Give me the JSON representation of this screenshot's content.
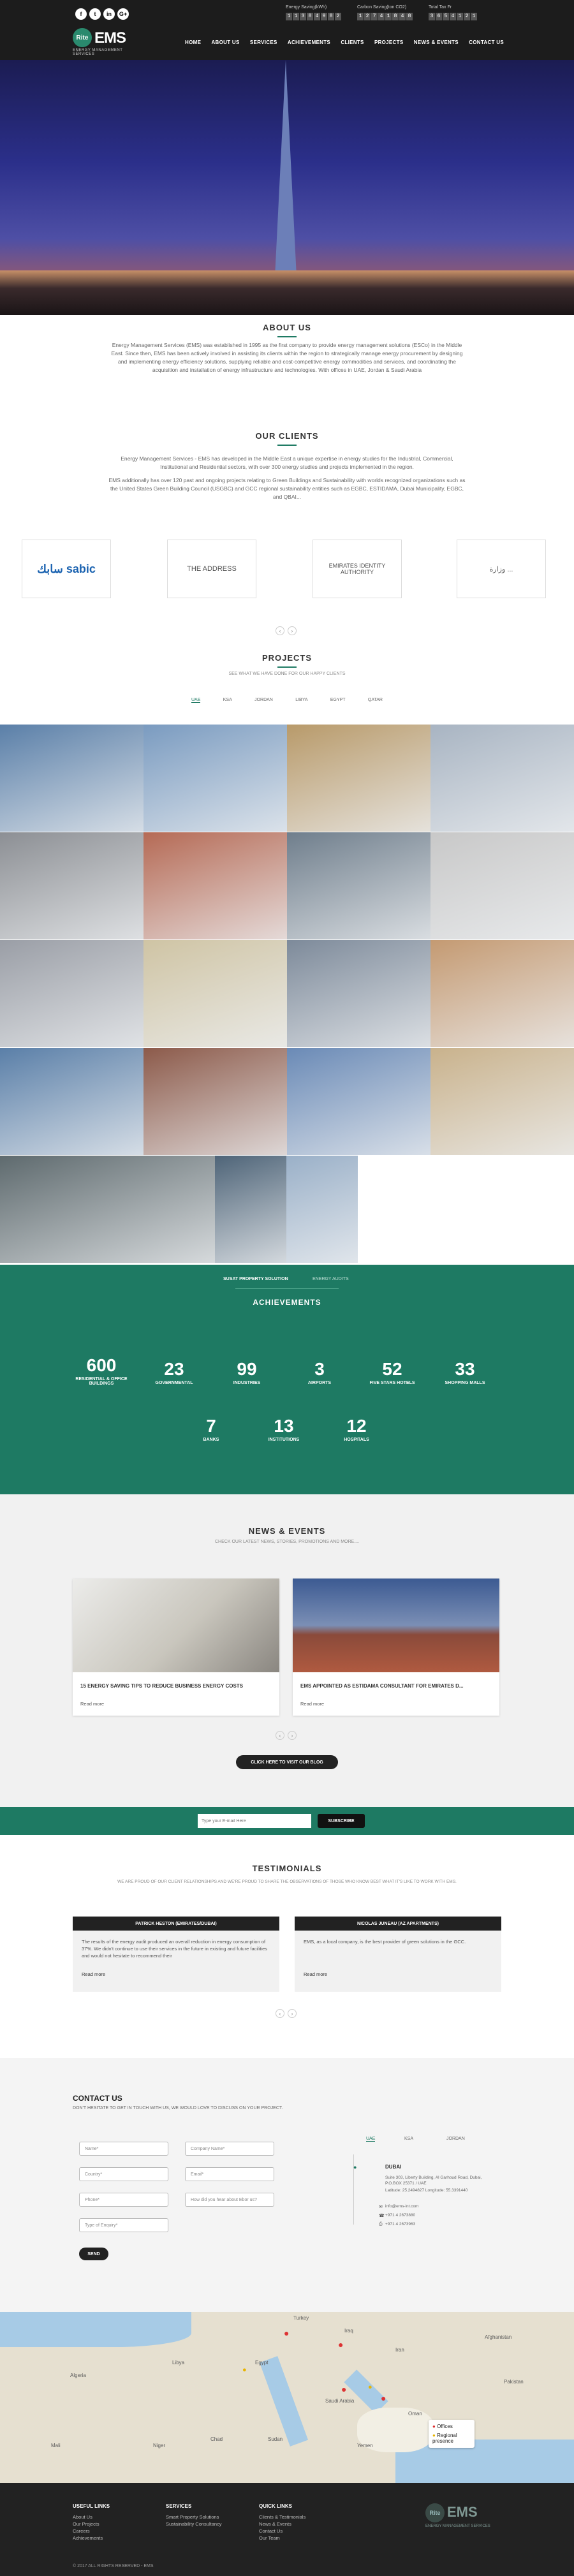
{
  "header": {
    "social": [
      "f",
      "t",
      "in",
      "G+"
    ],
    "logo": {
      "mark": "Rite",
      "name": "EMS",
      "tagline": "ENERGY MANAGEMENT SERVICES"
    },
    "stats": [
      {
        "label": "Energy Saving(kWh)",
        "digits": "11384982"
      },
      {
        "label": "Carbon Saving(ton CO2)",
        "digits": "12741848"
      },
      {
        "label": "Total Tax Fr",
        "digits": "3654121"
      }
    ],
    "nav": [
      "HOME",
      "ABOUT US",
      "SERVICES",
      "ACHIEVEMENTS",
      "CLIENTS",
      "PROJECTS",
      "NEWS & EVENTS",
      "CONTACT US"
    ]
  },
  "about": {
    "title": "ABOUT US",
    "text": "Energy Management Services (EMS) was established in 1995 as the first company to provide energy management solutions (ESCo) in the Middle East. Since then, EMS has been actively involved in assisting its clients within the region to strategically manage energy procurement by designing and implementing energy efficiency solutions, supplying reliable and cost-competitive energy commodities and services, and coordinating the acquisition and installation of energy infrastructure and technologies. With offices in UAE, Jordan & Saudi Arabia"
  },
  "clients": {
    "title": "OUR CLIENTS",
    "text1": "Energy Management Services - EMS has developed in the Middle East a unique expertise in energy studies for the Industrial, Commercial, Institutional and Residential sectors, with over 300 energy studies and projects implemented in the region.",
    "text2": "EMS additionally has over 120 past and ongoing projects relating to Green Buildings and Sustainability with worlds recognized organizations such as the United States Green Building Council (USGBC) and GCC regional sustainability entities such as EGBC, ESTIDAMA, Dubai Municipality, EGBC, and QBAI...",
    "logos": [
      "سابك sabic",
      "THE ADDRESS",
      "EMIRATES IDENTITY AUTHORITY",
      "وزارة ..."
    ]
  },
  "projects": {
    "title": "PROJECTS",
    "subtitle": "SEE WHAT WE HAVE DONE FOR OUR HAPPY CLIENTS",
    "tabs": [
      "UAE",
      "KSA",
      "JORDAN",
      "LIBYA",
      "EGYPT",
      "QATAR"
    ]
  },
  "achievements": {
    "title": "ACHIEVEMENTS",
    "tabs": [
      "SUSAT PROPERTY SOLUTION",
      "ENERGY AUDITS"
    ],
    "items": [
      {
        "n": "600",
        "l": "RESIDENTIAL & OFFICE BUILDINGS"
      },
      {
        "n": "23",
        "l": "GOVERNMENTAL"
      },
      {
        "n": "99",
        "l": "INDUSTRIES"
      },
      {
        "n": "3",
        "l": "AIRPORTS"
      },
      {
        "n": "52",
        "l": "FIVE STARS HOTELS"
      },
      {
        "n": "33",
        "l": "SHOPPING MALLS"
      },
      {
        "n": "7",
        "l": "BANKS"
      },
      {
        "n": "13",
        "l": "INSTITUTIONS"
      },
      {
        "n": "12",
        "l": "HOSPITALS"
      }
    ]
  },
  "news": {
    "title": "NEWS & EVENTS",
    "subtitle": "CHECK OUR LATEST NEWS, STORIES, PROMOTIONS AND MORE....",
    "cards": [
      {
        "title": "15 ENERGY SAVING TIPS TO REDUCE BUSINESS ENERGY COSTS",
        "more": "Read more"
      },
      {
        "title": "EMS APPOINTED AS ESTIDAMA CONSULTANT FOR EMIRATES D...",
        "more": "Read more"
      }
    ],
    "blog_button": "CLICK HERE TO VISIT OUR BLOG"
  },
  "newsletter": {
    "placeholder": "Type your E-mail Here",
    "button": "SUBSCRIBE"
  },
  "testimonials": {
    "title": "TESTIMONIALS",
    "subtitle": "WE ARE PROUD OF OUR CLIENT RELATIONSHIPS AND WE'RE PROUD TO SHARE THE OBSERVATIONS OF THOSE WHO KNOW BEST WHAT IT'S LIKE TO WORK WITH EMS.",
    "cards": [
      {
        "name": "PATRICK HESTON (EMIRATES/DUBAI)",
        "text": "The results of the energy audit produced an overall reduction in energy consumption of 37%. We didn't continue to use their services in the future in existing and future facilities and would not hesitate to recommend their",
        "more": "Read more"
      },
      {
        "name": "NICOLAS JUNEAU (AZ APARTMENTS)",
        "text": "EMS, as a local company, is the best provider of green solutions in the GCC.",
        "more": "Read more"
      }
    ]
  },
  "contact": {
    "title": "CONTACT US",
    "subtitle": "DON'T HESITATE TO GET IN TOUCH WITH US, WE WOULD LOVE TO DISCUSS ON YOUR PROJECT.",
    "fields": [
      "Name*",
      "Company Name*",
      "Country*",
      "Email*",
      "Phone*",
      "How did you hear about Ebor us?",
      "Type of Enquiry*"
    ],
    "send": "SEND",
    "office_tabs": [
      "UAE",
      "KSA",
      "JORDAN"
    ],
    "office": {
      "city": "DUBAI",
      "address": "Suite 303, Liberty Building, Al Garhoud Road, Dubai, P.O.BOX 25371 / UAE",
      "coords": "Latitude: 25.2494827 Longitude: 55.3391440",
      "email": "info@ems-int.com",
      "phone": "+971 4 2673880",
      "fax": "+971 4 2673963"
    }
  },
  "map": {
    "legend": [
      "Offices",
      "Regional presence"
    ],
    "labels": [
      "Algeria",
      "Libya",
      "Egypt",
      "Saudi Arabia",
      "Iran",
      "Afghanistan",
      "Pakistan",
      "Mali",
      "Niger",
      "Chad",
      "Sudan",
      "Yemen",
      "Oman",
      "Iraq",
      "Turkey"
    ]
  },
  "footer": {
    "cols": [
      {
        "h": "USEFUL LINKS",
        "items": [
          "About Us",
          "Our Projects",
          "Careers",
          "Achievements"
        ]
      },
      {
        "h": "SERVICES",
        "items": [
          "Smart Property Solutions",
          "Sustainability Consultancy"
        ]
      },
      {
        "h": "QUICK LINKS",
        "items": [
          "Clients & Testimonials",
          "News & Events",
          "Contact Us",
          "Our Team"
        ]
      }
    ],
    "copyright": "© 2017 ALL RIGHTS RESERVED - EMS"
  },
  "colors": {
    "accent": "#1e7a63",
    "dark": "#222222"
  }
}
